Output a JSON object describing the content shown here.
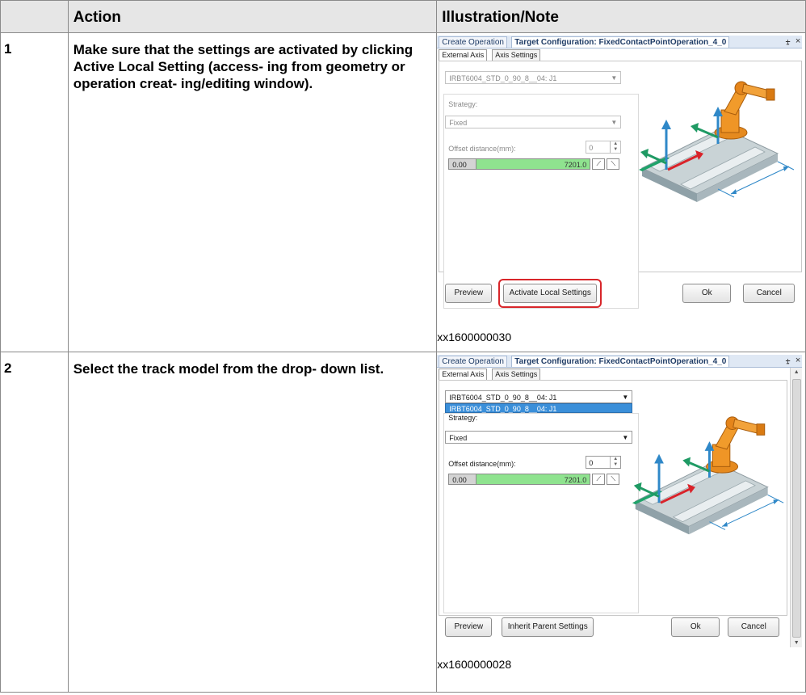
{
  "table": {
    "headers": {
      "step": "",
      "action": "Action",
      "note": "Illustration/Note"
    },
    "rows": [
      {
        "step": "1",
        "action_before": "Make sure that the settings are activated by clicking ",
        "action_bold": "Active Local Setting",
        "action_after": " (access- ing from geometry or operation creat- ing/editing window).",
        "caption": "xx1600000030",
        "shot": {
          "tab_create": "Create Operation",
          "tab_target": "Target Configuration: FixedContactPointOperation_4_0",
          "win_pin": "⨦",
          "win_close": "×",
          "subtab_external": "External Axis",
          "subtab_axis": "Axis Settings",
          "axis_combo": "IRBT6004_STD_0_90_8__04: J1",
          "strategy_label": "Strategy:",
          "strategy_value": "Fixed",
          "offset_label": "Offset distance(mm):",
          "offset_value": "0",
          "slider_min": "0.00",
          "slider_max": "7201.0",
          "btn_preview": "Preview",
          "btn_settings": "Activate Local Settings",
          "btn_ok": "Ok",
          "btn_cancel": "Cancel"
        }
      },
      {
        "step": "2",
        "action": "Select the track model from the drop- down list.",
        "caption": "xx1600000028",
        "shot": {
          "tab_create": "Create Operation",
          "tab_target": "Target Configuration: FixedContactPointOperation_4_0",
          "win_pin": "⨦",
          "win_close": "×",
          "subtab_external": "External Axis",
          "subtab_axis": "Axis Settings",
          "axis_combo": "IRBT6004_STD_0_90_8__04: J1",
          "axis_dropdown_item": "IRBT6004_STD_0_90_8__04: J1",
          "strategy_label": "Strategy:",
          "strategy_value": "Fixed",
          "offset_label": "Offset distance(mm):",
          "offset_value": "0",
          "slider_min": "0.00",
          "slider_max": "7201.0",
          "btn_preview": "Preview",
          "btn_settings": "Inherit Parent Settings",
          "btn_ok": "Ok",
          "btn_cancel": "Cancel"
        }
      }
    ]
  },
  "colors": {
    "border": "#8a8a8a",
    "header_bg": "#e6e6e6",
    "highlight_ring": "#d8262a",
    "slider_fill": "#8fe38f",
    "dropdown_select": "#3b8fd9"
  }
}
